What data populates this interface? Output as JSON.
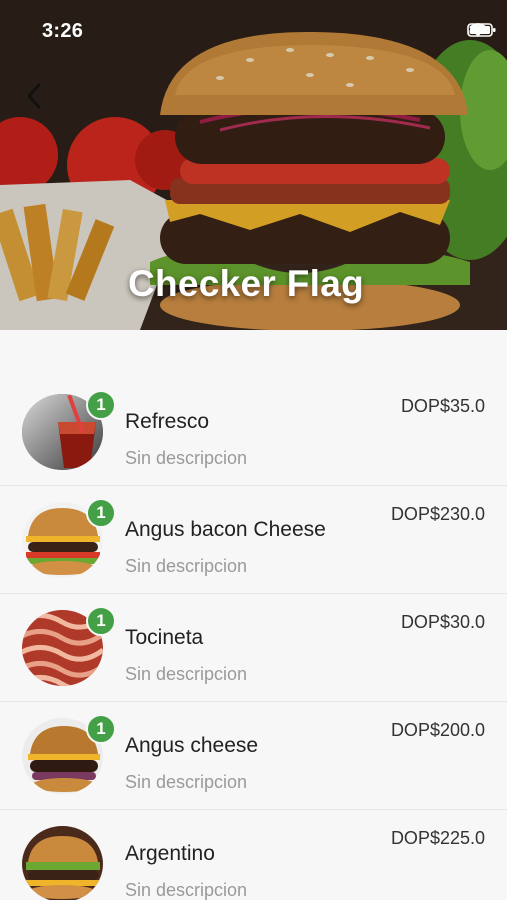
{
  "status_bar": {
    "time": "3:26"
  },
  "header": {
    "title": "Checker Flag",
    "back_icon": "chevron-left-icon"
  },
  "badge_color": "#43a047",
  "items": [
    {
      "name": "Refresco",
      "description": "Sin descripcion",
      "price": "DOP$35.0",
      "quantity": "1"
    },
    {
      "name": "Angus bacon Cheese",
      "description": "Sin descripcion",
      "price": "DOP$230.0",
      "quantity": "1"
    },
    {
      "name": "Tocineta",
      "description": "Sin descripcion",
      "price": "DOP$30.0",
      "quantity": "1"
    },
    {
      "name": "Angus cheese",
      "description": "Sin descripcion",
      "price": "DOP$200.0",
      "quantity": "1"
    },
    {
      "name": "Argentino",
      "description": "Sin descripcion",
      "price": "DOP$225.0"
    }
  ]
}
